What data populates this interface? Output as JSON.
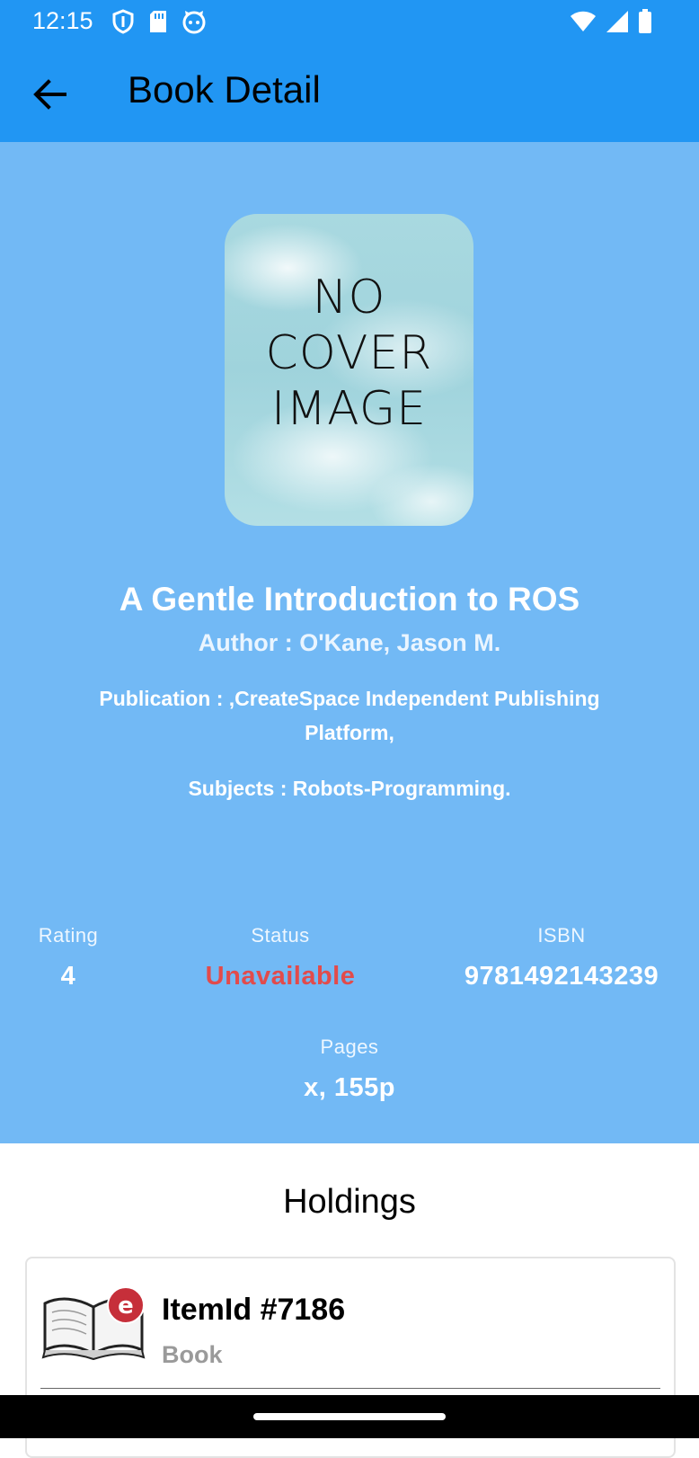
{
  "status_bar": {
    "time": "12:15",
    "left_icons": [
      "shield-icon",
      "sd-card-icon",
      "cat-icon"
    ],
    "right_icons": [
      "wifi-icon",
      "signal-icon",
      "battery-icon"
    ]
  },
  "appbar": {
    "title": "Book Detail",
    "back_icon": "arrow-back-icon",
    "color": "#2196f3"
  },
  "book": {
    "cover_text": "NO\nCOVER\nIMAGE",
    "title": "A Gentle Introduction to ROS",
    "author": "Author : O'Kane, Jason M.",
    "publication": "Publication :  ,CreateSpace Independent Publishing Platform,",
    "subjects": "Subjects : Robots-Programming.",
    "background_color": "#72b9f5"
  },
  "stats": {
    "rating": {
      "label": "Rating",
      "value": "4"
    },
    "status": {
      "label": "Status",
      "value": "Unavailable",
      "color": "#e24b4b"
    },
    "isbn": {
      "label": "ISBN",
      "value": "9781492143239"
    },
    "pages": {
      "label": "Pages",
      "value": "x, 155p"
    }
  },
  "holdings": {
    "title": "Holdings",
    "items": [
      {
        "id_label": "ItemId #7186",
        "type": "Book",
        "icon": "ebook-icon"
      }
    ]
  }
}
